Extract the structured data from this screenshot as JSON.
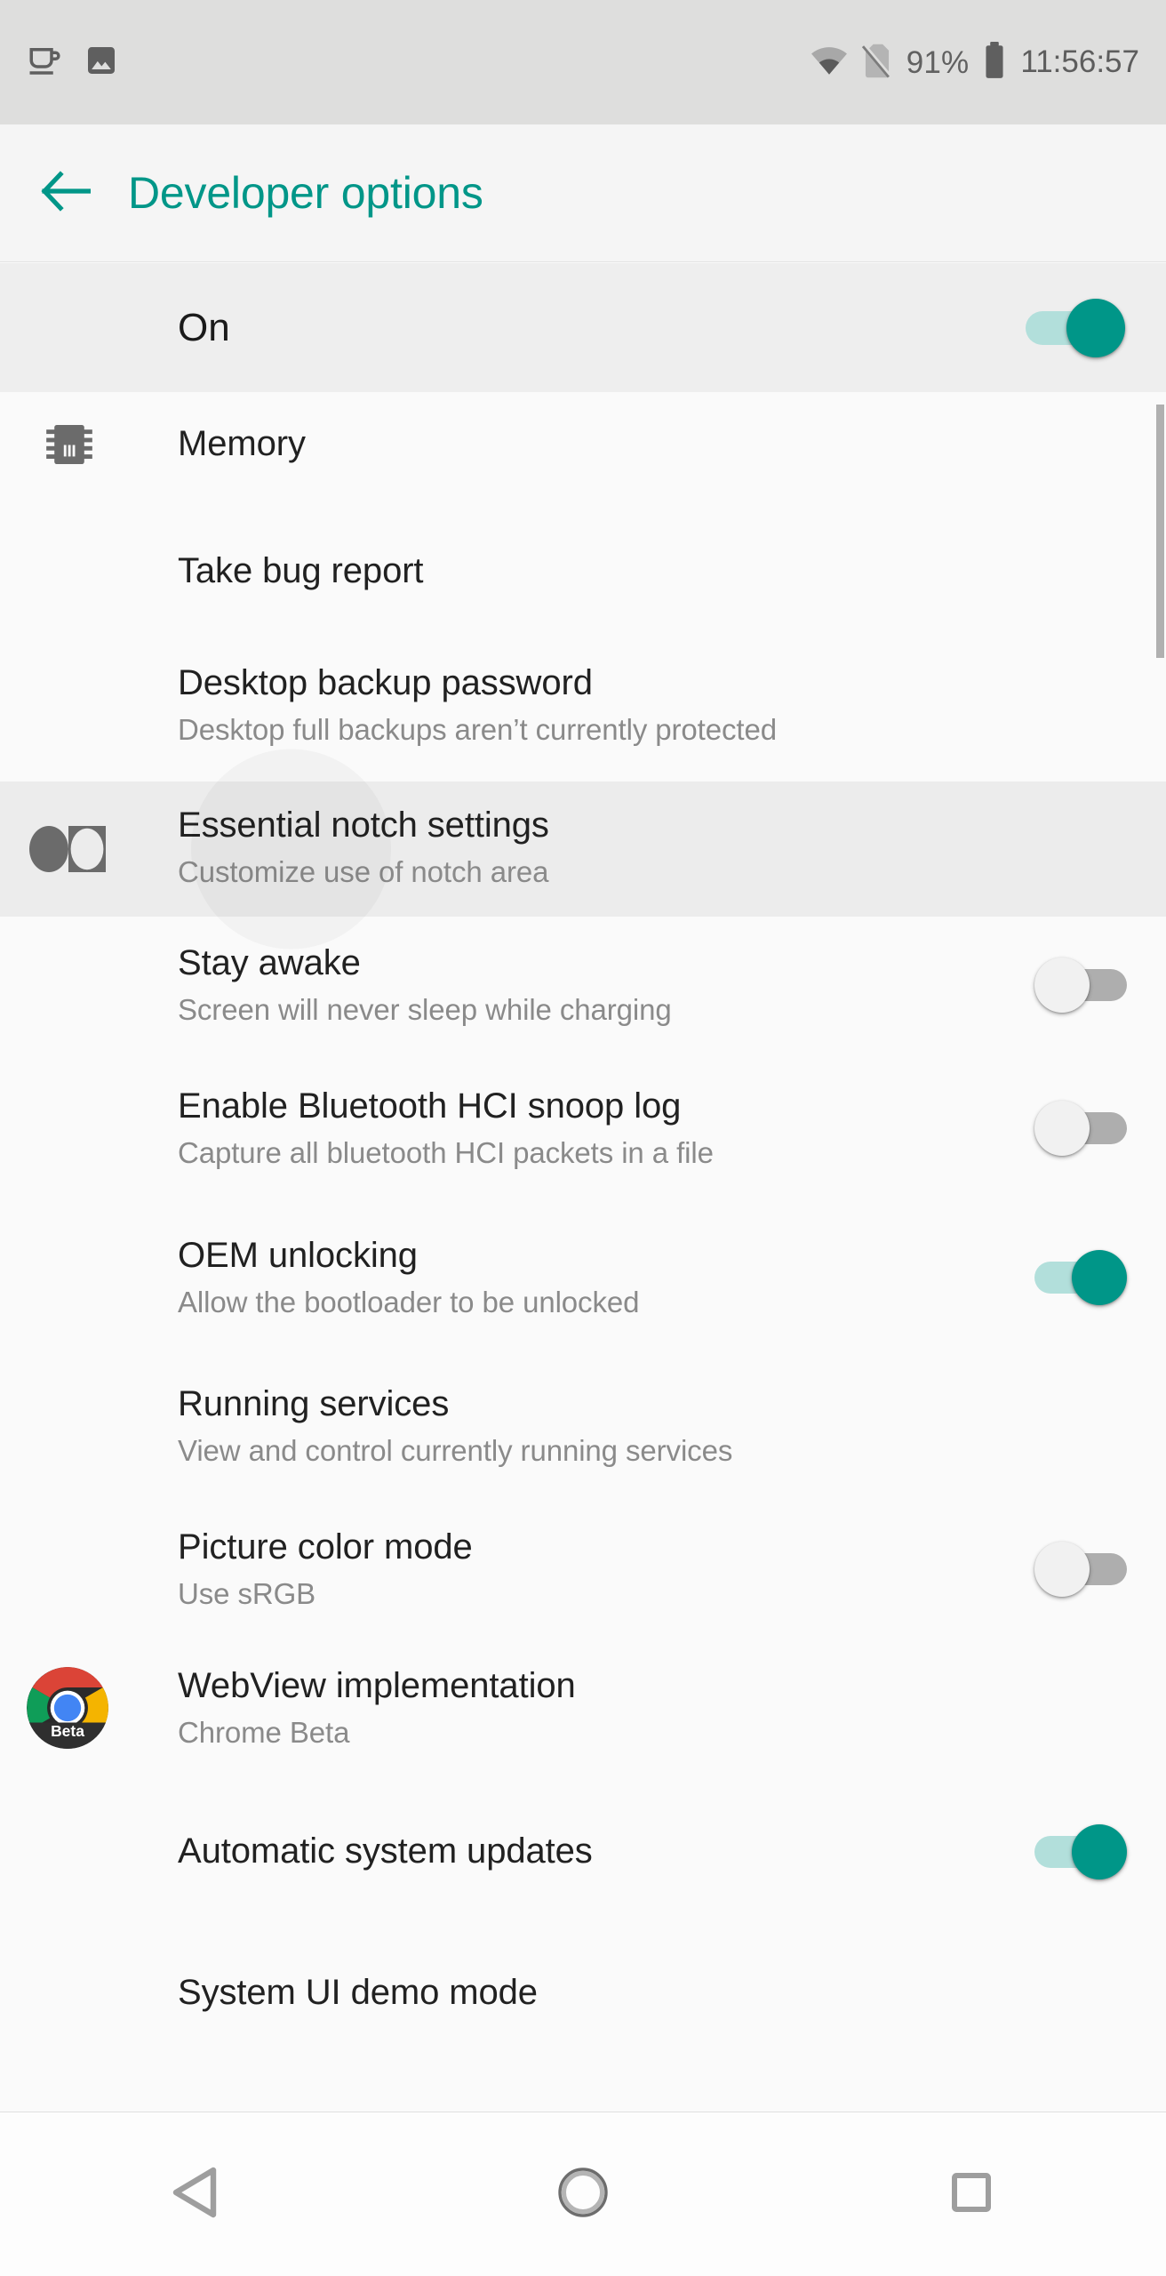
{
  "statusbar": {
    "left_icons": [
      {
        "name": "coffee-cup-icon"
      },
      {
        "name": "image-icon"
      }
    ],
    "wifi_icon": "wifi-icon",
    "sim_icon": "no-sim-icon",
    "battery_percent": "91%",
    "battery_icon": "battery-icon",
    "clock": "11:56:57"
  },
  "appbar": {
    "back_icon": "arrow-left-icon",
    "title": "Developer options",
    "accent_color": "#009688"
  },
  "master_switch": {
    "label": "On",
    "state": "on"
  },
  "list": {
    "items": [
      {
        "title": "Memory",
        "subtitle": "",
        "icon": "memory-chip-icon",
        "control": "none",
        "highlight": false
      },
      {
        "title": "Take bug report",
        "subtitle": "",
        "icon": "",
        "control": "none",
        "highlight": false
      },
      {
        "title": "Desktop backup password",
        "subtitle": "Desktop full backups aren’t currently protected",
        "icon": "",
        "control": "none",
        "highlight": false
      },
      {
        "title": "Essential notch settings",
        "subtitle": "Customize use of notch area",
        "icon": "essential-notch-icon",
        "control": "none",
        "highlight": true
      },
      {
        "title": "Stay awake",
        "subtitle": "Screen will never sleep while charging",
        "icon": "",
        "control": "switch",
        "state": "off",
        "highlight": false
      },
      {
        "title": "Enable Bluetooth HCI snoop log",
        "subtitle": "Capture all bluetooth HCI packets in a file",
        "icon": "",
        "control": "switch",
        "state": "off",
        "highlight": false
      },
      {
        "title": "OEM unlocking",
        "subtitle": "Allow the bootloader to be unlocked",
        "icon": "",
        "control": "switch",
        "state": "on",
        "highlight": false
      },
      {
        "title": "Running services",
        "subtitle": "View and control currently running services",
        "icon": "",
        "control": "none",
        "highlight": false
      },
      {
        "title": "Picture color mode",
        "subtitle": "Use sRGB",
        "icon": "",
        "control": "switch",
        "state": "off",
        "highlight": false
      },
      {
        "title": "WebView implementation",
        "subtitle": "Chrome Beta",
        "icon": "chrome-beta-icon",
        "icon_label": "Beta",
        "control": "none",
        "highlight": false
      },
      {
        "title": "Automatic system updates",
        "subtitle": "",
        "icon": "",
        "control": "switch",
        "state": "on",
        "highlight": false
      },
      {
        "title": "System UI demo mode",
        "subtitle": "",
        "icon": "",
        "control": "none",
        "highlight": false
      }
    ]
  },
  "navbar": {
    "back": "back-triangle-icon",
    "home": "home-circle-icon",
    "recents": "recents-square-icon"
  }
}
